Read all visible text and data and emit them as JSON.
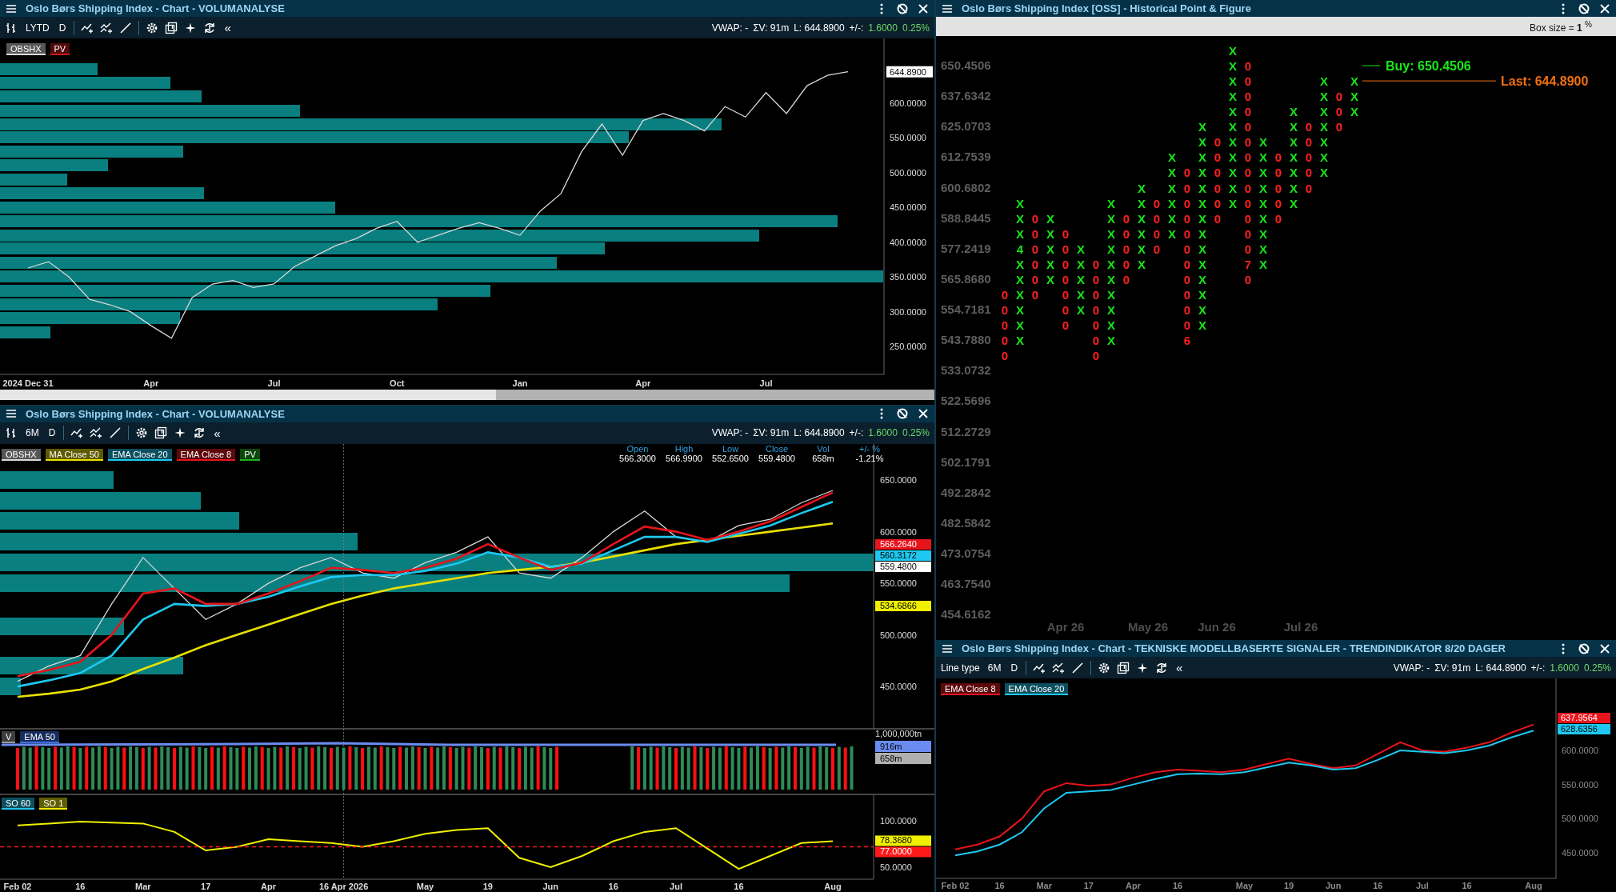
{
  "price_panel": {
    "title": "Oslo Børs Shipping Index - Chart - VOLUMANALYSE",
    "toolbar": {
      "periods": [
        "LYTD",
        "D"
      ],
      "collapse": "«"
    },
    "stats": {
      "vwap": "VWAP: -",
      "volume": "ΣV: 91m",
      "last": "L: 644.8900",
      "change_label": "+/-:",
      "change": "1.6000",
      "change_pct": "0.25%"
    },
    "extra_legend": [
      {
        "label": "PV",
        "color": "#d01818"
      }
    ],
    "last_price": "644.8900",
    "chart_data": {
      "type": "line",
      "categories": [
        "2024 Dec 31",
        null,
        null,
        null,
        null,
        null,
        "Apr",
        null,
        null,
        null,
        null,
        null,
        "Jul",
        null,
        null,
        null,
        null,
        null,
        "Oct",
        null,
        null,
        null,
        null,
        null,
        "Jan",
        null,
        null,
        null,
        null,
        null,
        "Apr",
        null,
        null,
        null,
        null,
        null,
        "Jul",
        null,
        null,
        null,
        null
      ],
      "series": [
        {
          "name": "OBSHX",
          "color": "#d8d8d8",
          "values": [
            363,
            372,
            350,
            318,
            310,
            300,
            280,
            262,
            320,
            340,
            345,
            335,
            340,
            365,
            380,
            395,
            405,
            420,
            430,
            400,
            410,
            420,
            428,
            420,
            410,
            445,
            470,
            530,
            570,
            525,
            575,
            585,
            575,
            560,
            595,
            580,
            615,
            585,
            625,
            640,
            645
          ]
        }
      ],
      "ylim": [
        210,
        693
      ],
      "yticks": [
        {
          "value": 600,
          "label": "600.0000"
        },
        {
          "value": 550,
          "label": "550.0000"
        },
        {
          "value": 500,
          "label": "500.0000"
        },
        {
          "value": 450,
          "label": "450.0000"
        },
        {
          "value": 400,
          "label": "400.0000"
        },
        {
          "value": 350,
          "label": "350.0000"
        },
        {
          "value": 300,
          "label": "300.0000"
        },
        {
          "value": 250,
          "label": "250.0000"
        }
      ]
    }
  },
  "pnf_panel": {
    "title": "Oslo Børs Shipping Index [OSS] - Historical Point & Figure",
    "box_size": "Box size = **1** $^{%}$",
    "price_labels": [
      "650.4506",
      "637.6342",
      "625.0703",
      "612.7539",
      "600.6802",
      "588.8445",
      "577.2419",
      "565.8680",
      "554.7181",
      "543.7880",
      "533.0732",
      "522.5696",
      "512.2729",
      "502.1791",
      "492.2842",
      "482.5842",
      "473.0754",
      "463.7540",
      "454.6162"
    ],
    "month_labels": [
      "Apr 26",
      "May 26",
      "Jun 26",
      "Jul 26"
    ],
    "columns": [
      {
        "kind": "o",
        "marks": "                00000"
      },
      {
        "kind": "x",
        "marks": "          XXX4XXXXXX"
      },
      {
        "kind": "o",
        "marks": "           000000"
      },
      {
        "kind": "x",
        "marks": "           XXXXX"
      },
      {
        "kind": "o",
        "marks": "            0000000"
      },
      {
        "kind": "x",
        "marks": "             XXXXX"
      },
      {
        "kind": "o",
        "marks": "              0000000"
      },
      {
        "kind": "x",
        "marks": "          XXXXXXXXXX"
      },
      {
        "kind": "o",
        "marks": "           00000"
      },
      {
        "kind": "x",
        "marks": "         XXXXXX"
      },
      {
        "kind": "o",
        "marks": "          0000"
      },
      {
        "kind": "x",
        "marks": "       XXXXXX"
      },
      {
        "kind": "o",
        "marks": "        000000000006"
      },
      {
        "kind": "x",
        "marks": "     XXXXXXXXXXXXXX"
      },
      {
        "kind": "o",
        "marks": "      000000"
      },
      {
        "kind": "x",
        "marks": "XXXXXXXXXXX"
      },
      {
        "kind": "o",
        "marks": " 000000000000070"
      },
      {
        "kind": "x",
        "marks": "      XXXXXXXXX"
      },
      {
        "kind": "o",
        "marks": "       00000"
      },
      {
        "kind": "x",
        "marks": "    XXXXXXX"
      },
      {
        "kind": "o",
        "marks": "     00000"
      },
      {
        "kind": "x",
        "marks": "  XXXXXXX"
      },
      {
        "kind": "o",
        "marks": "   000"
      },
      {
        "kind": "x",
        "marks": "  XXX"
      }
    ],
    "buy_label": "Buy: 650.4506",
    "last_label": "Last: 644.8900"
  },
  "indicator_panel": {
    "title": "Oslo Børs Shipping Index - Chart - VOLUMANALYSE",
    "toolbar": {
      "periods": [
        "6M",
        "D"
      ],
      "collapse": "«"
    },
    "stats": {
      "vwap": "VWAP: -",
      "volume": "ΣV: 91m",
      "last": "L: 644.8900",
      "change_label": "+/-:",
      "change": "1.6000",
      "change_pct": "0.25%"
    },
    "extra_legend": [
      {
        "label": "PV",
        "color": "#20b020"
      }
    ],
    "quote": [
      {
        "label": "Open",
        "value": "566.3000"
      },
      {
        "label": "High",
        "value": "566.9900"
      },
      {
        "label": "Low",
        "value": "552.6500"
      },
      {
        "label": "Close",
        "value": "559.4800"
      },
      {
        "label": "Vol",
        "value": "658m"
      },
      {
        "label": "+/- %",
        "value": "-1.21%"
      }
    ],
    "price_markers": [
      {
        "value": "566.2640",
        "color": "#e8141c"
      },
      {
        "value": "560.3172",
        "color": "#1ec8f0"
      },
      {
        "value": "559.4800",
        "color": "#ffffff"
      },
      {
        "value": "534.6866",
        "color": "#f0f000"
      }
    ],
    "crosshair_label": "16 Apr 2026",
    "chart_data": {
      "type": "line",
      "categories": [
        null,
        null,
        null,
        null,
        null,
        null,
        null,
        null,
        null,
        null,
        null,
        null,
        null,
        null,
        null,
        null,
        null,
        null,
        null,
        null,
        null,
        null,
        null,
        null,
        null,
        null,
        null
      ],
      "series": [
        {
          "name": "OBSHX",
          "color": "#d8d8d8",
          "values": [
            455,
            470,
            480,
            530,
            575,
            545,
            515,
            530,
            550,
            565,
            575,
            560,
            555,
            570,
            580,
            595,
            560,
            555,
            575,
            600,
            620,
            595,
            590,
            606,
            612,
            628,
            640
          ]
        },
        {
          "name": "MA Close 50",
          "color": "#e8e000",
          "values": [
            440,
            443,
            447,
            455,
            467,
            478,
            490,
            500,
            510,
            520,
            530,
            538,
            545,
            550,
            555,
            560,
            563,
            566,
            570,
            576,
            582,
            588,
            592,
            596,
            600,
            604,
            608
          ]
        },
        {
          "name": "EMA Close 20",
          "color": "#1ec8f0",
          "values": [
            450,
            456,
            463,
            480,
            515,
            530,
            528,
            530,
            537,
            547,
            556,
            558,
            558,
            562,
            569,
            580,
            575,
            566,
            569,
            582,
            595,
            595,
            590,
            598,
            606,
            618,
            629
          ]
        },
        {
          "name": "EMA Close 8",
          "color": "#e8141c",
          "values": [
            460,
            466,
            474,
            500,
            540,
            545,
            530,
            530,
            540,
            552,
            565,
            563,
            560,
            565,
            574,
            588,
            575,
            563,
            570,
            588,
            605,
            600,
            592,
            600,
            610,
            624,
            638
          ]
        }
      ],
      "ylim": [
        409,
        685
      ],
      "yticks": [
        {
          "value": 650,
          "label": "650.0000"
        },
        {
          "value": 600,
          "label": "600.0000"
        },
        {
          "value": 550,
          "label": "550.0000"
        },
        {
          "value": 500,
          "label": "500.0000"
        },
        {
          "value": 450,
          "label": "450.0000"
        }
      ]
    },
    "volume": {
      "legend": [
        {
          "label": "V",
          "color": "#9a9a9a"
        },
        {
          "label": "EMA 50",
          "color": "#3a6ee8"
        }
      ],
      "scale_label": "1,000,000tn",
      "markers": [
        {
          "value": "916m",
          "color": "#6a8cf0"
        },
        {
          "value": "658m",
          "color": "#b0b0b0"
        }
      ]
    },
    "oscillator": {
      "extra_legend": [
        {
          "label": "SO 60",
          "color": "#1ec8f0"
        }
      ],
      "markers": [
        {
          "value": "78.3680",
          "color": "#f0f000"
        },
        {
          "value": "77.0000",
          "color": "#ff1a1a"
        }
      ],
      "chart_data": {
        "type": "line",
        "categories": [
          "Feb 02",
          null,
          "16",
          null,
          "Mar",
          null,
          "17",
          null,
          "Apr",
          null,
          null,
          null,
          null,
          "May",
          null,
          "19",
          null,
          "Jun",
          null,
          "16",
          null,
          "Jul",
          null,
          "16",
          null,
          null,
          "Aug"
        ],
        "series": [
          {
            "name": "SO 1",
            "color": "#f0f000",
            "values": [
              95,
              97,
              99,
              98,
              97,
              88,
              68,
              72,
              80,
              78,
              76,
              72,
              78,
              86,
              90,
              92,
              60,
              50,
              62,
              78,
              88,
              92,
              70,
              48,
              62,
              76,
              78
            ]
          }
        ],
        "ylim": [
          37,
          128.4
        ],
        "yticks": [
          {
            "value": 100,
            "label": "100.0000"
          },
          {
            "value": 50,
            "label": "50.0000"
          }
        ]
      }
    }
  },
  "signal_panel": {
    "title": "Oslo Børs Shipping Index - Chart - TEKNISKE MODELLBASERTE SIGNALER - TRENDINDIKATOR 8/20 DAGER",
    "toolbar": {
      "label": "Line type",
      "periods": [
        "6M",
        "D"
      ],
      "collapse": "«"
    },
    "stats": {
      "vwap": "VWAP: -",
      "volume": "ΣV: 91m",
      "last": "L: 644.8900",
      "change_label": "+/-:",
      "change": "1.6000",
      "change_pct": "0.25%"
    },
    "price_markers": [
      {
        "value": "637.9564",
        "color": "#e8141c"
      },
      {
        "value": "628.6356",
        "color": "#1ec8f0"
      }
    ],
    "chart_data": {
      "type": "line",
      "categories": [
        "Feb 02",
        null,
        "16",
        null,
        "Mar",
        null,
        "17",
        null,
        "Apr",
        null,
        "16",
        null,
        null,
        "May",
        null,
        "19",
        null,
        "Jun",
        null,
        "16",
        null,
        "Jul",
        null,
        "16",
        null,
        null,
        "Aug"
      ],
      "series": [
        {
          "name": "EMA Close 8",
          "color": "#e8141c",
          "values": [
            455,
            462,
            474,
            500,
            540,
            552,
            548,
            550,
            560,
            568,
            572,
            570,
            568,
            572,
            580,
            588,
            580,
            574,
            578,
            595,
            612,
            600,
            598,
            604,
            612,
            626,
            638
          ]
        },
        {
          "name": "EMA Close 20",
          "color": "#1ec8f0",
          "values": [
            446,
            452,
            462,
            480,
            515,
            538,
            540,
            542,
            550,
            558,
            565,
            566,
            565,
            568,
            575,
            582,
            578,
            572,
            574,
            586,
            600,
            598,
            596,
            600,
            607,
            619,
            629
          ]
        }
      ],
      "ylim": [
        412.4,
        705.5
      ],
      "yticks": [
        {
          "value": 600,
          "label": "600.0000"
        },
        {
          "value": 550,
          "label": "550.0000"
        },
        {
          "value": 500,
          "label": "500.0000"
        },
        {
          "value": 450,
          "label": "450.0000"
        }
      ]
    }
  }
}
